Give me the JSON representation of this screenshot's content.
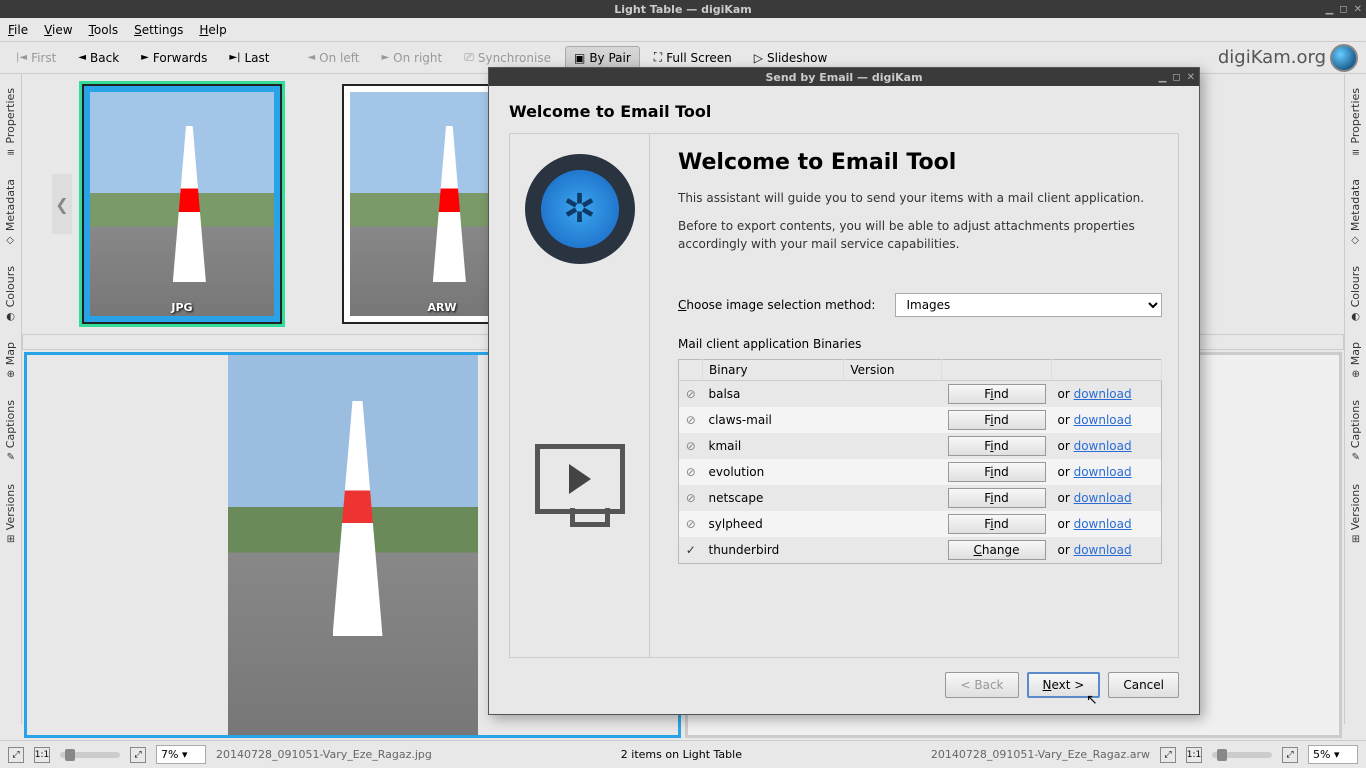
{
  "main_window": {
    "title": "Light Table — digiKam",
    "brand": "digiKam.org"
  },
  "menubar": {
    "file": "File",
    "view": "View",
    "tools": "Tools",
    "settings": "Settings",
    "help": "Help"
  },
  "toolbar": {
    "first": "First",
    "back": "Back",
    "forwards": "Forwards",
    "last": "Last",
    "on_left": "On left",
    "on_right": "On right",
    "synchronise": "Synchronise",
    "by_pair": "By Pair",
    "full_screen": "Full Screen",
    "slideshow": "Slideshow"
  },
  "side_tabs": {
    "properties": "Properties",
    "metadata": "Metadata",
    "colours": "Colours",
    "map": "Map",
    "captions": "Captions",
    "versions": "Versions"
  },
  "thumbs": [
    {
      "label": "JPG"
    },
    {
      "label": "ARW"
    }
  ],
  "statusbar": {
    "left_zoom": "7%",
    "left_file": "20140728_091051-Vary_Eze_Ragaz.jpg",
    "center": "2 items on Light Table",
    "right_file": "20140728_091051-Vary_Eze_Ragaz.arw",
    "right_zoom": "5%"
  },
  "dialog": {
    "title": "Send by Email — digiKam",
    "heading": "Welcome to Email Tool",
    "main_heading": "Welcome to Email Tool",
    "para1": "This assistant will guide you to send your items with a mail client application.",
    "para2": "Before to export contents, you will be able to adjust attachments properties accordingly with your mail service capabilities.",
    "choose_label": "Choose image selection method:",
    "choose_value": "Images",
    "binaries_label": "Mail client application Binaries",
    "th_binary": "Binary",
    "th_version": "Version",
    "or_text": "or ",
    "download_text": "download",
    "find_label": "Find",
    "change_label": "Change",
    "rows": [
      {
        "name": "balsa",
        "found": false
      },
      {
        "name": "claws-mail",
        "found": false
      },
      {
        "name": "kmail",
        "found": false
      },
      {
        "name": "evolution",
        "found": false
      },
      {
        "name": "netscape",
        "found": false
      },
      {
        "name": "sylpheed",
        "found": false
      },
      {
        "name": "thunderbird",
        "found": true
      }
    ],
    "btn_back": "< Back",
    "btn_next": "Next >",
    "btn_cancel": "Cancel"
  }
}
